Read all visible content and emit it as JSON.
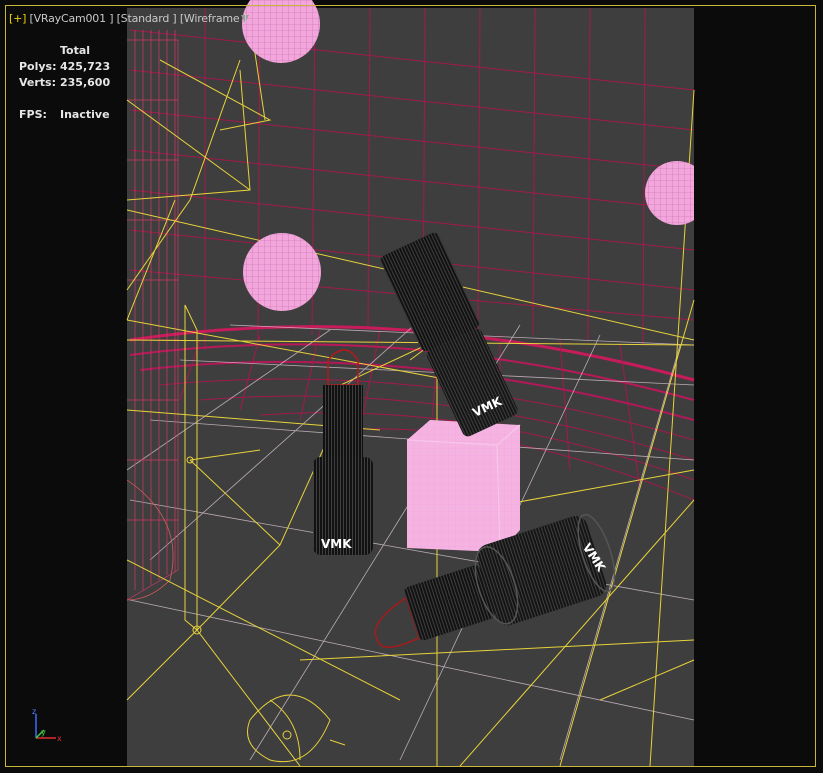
{
  "viewport": {
    "menu": {
      "plus": "[+]",
      "camera": "[VRayCam001 ]",
      "mode": "[Standard ]",
      "shading": "[Wireframe ]"
    },
    "stats": {
      "header": "Total",
      "polys_label": "Polys:",
      "polys_value": "425,723",
      "verts_label": "Verts:",
      "verts_value": "235,600",
      "fps_label": "FPS:",
      "fps_value": "Inactive"
    },
    "labels": {
      "lipstick_text": "VMK"
    },
    "axis": {
      "x": "x",
      "y": "y",
      "z": "z"
    },
    "colors": {
      "background": "#0b0b0b",
      "safe_frame": "#3e3e3e",
      "yellow_wire": "#e8d23a",
      "magenta_wire": "#c2185b",
      "pink_object": "#f08fd8",
      "frame_border": "#c9b63a"
    }
  }
}
